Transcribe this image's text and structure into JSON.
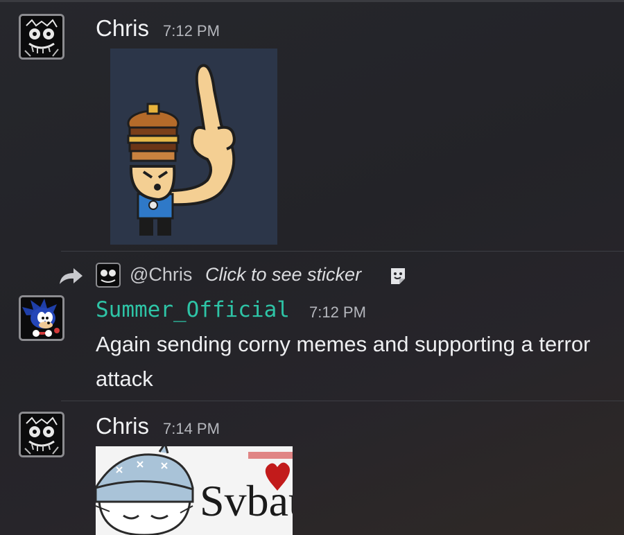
{
  "messages": [
    {
      "author": "Chris",
      "timestamp": "7:12 PM",
      "avatar_icon": "skull-sketch-avatar-icon",
      "attachment": "sticker-burger-head-pointing-finger"
    },
    {
      "reply": {
        "mention": "@Chris",
        "preview": "Click to see sticker",
        "reply_icon": "reply-arrow-icon",
        "sticker_icon": "sticker-icon"
      },
      "author": "Summer_Official",
      "author_color": "#2ec4a6",
      "timestamp": "7:12 PM",
      "avatar_icon": "sonic-avatar-icon",
      "text_line1": "Again sending corny memes and supporting a terror",
      "text_line2": "attack"
    },
    {
      "author": "Chris",
      "timestamp": "7:14 PM",
      "avatar_icon": "skull-sketch-avatar-icon",
      "attachment": "sticker-svbau-character",
      "attachment_text": "Svbau"
    }
  ],
  "colors": {
    "background": "#232328",
    "username": "#f2f3f5",
    "timestamp": "#b5b7bd",
    "accent_username": "#2ec4a6"
  }
}
